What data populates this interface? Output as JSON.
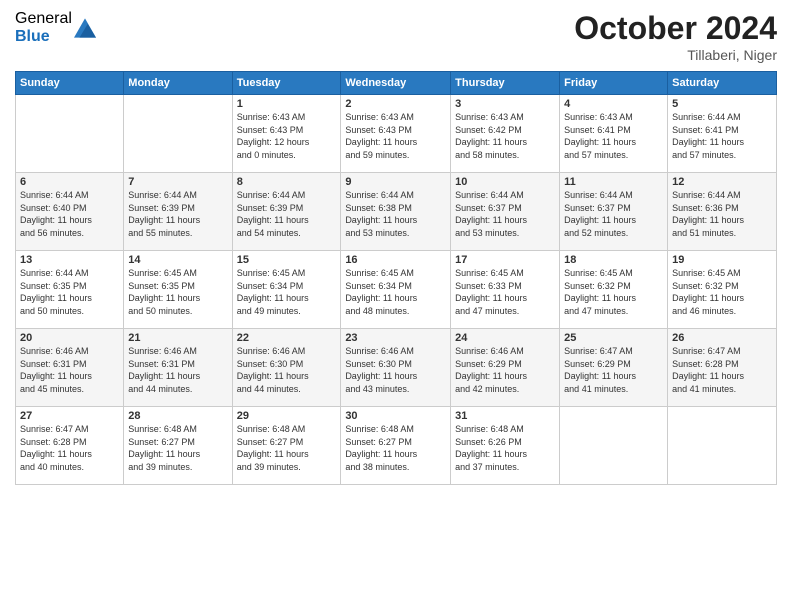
{
  "header": {
    "logo": {
      "general": "General",
      "blue": "Blue"
    },
    "title": "October 2024",
    "location": "Tillaberi, Niger"
  },
  "days_of_week": [
    "Sunday",
    "Monday",
    "Tuesday",
    "Wednesday",
    "Thursday",
    "Friday",
    "Saturday"
  ],
  "weeks": [
    [
      {
        "day": "",
        "info": ""
      },
      {
        "day": "",
        "info": ""
      },
      {
        "day": "1",
        "info": "Sunrise: 6:43 AM\nSunset: 6:43 PM\nDaylight: 12 hours\nand 0 minutes."
      },
      {
        "day": "2",
        "info": "Sunrise: 6:43 AM\nSunset: 6:43 PM\nDaylight: 11 hours\nand 59 minutes."
      },
      {
        "day": "3",
        "info": "Sunrise: 6:43 AM\nSunset: 6:42 PM\nDaylight: 11 hours\nand 58 minutes."
      },
      {
        "day": "4",
        "info": "Sunrise: 6:43 AM\nSunset: 6:41 PM\nDaylight: 11 hours\nand 57 minutes."
      },
      {
        "day": "5",
        "info": "Sunrise: 6:44 AM\nSunset: 6:41 PM\nDaylight: 11 hours\nand 57 minutes."
      }
    ],
    [
      {
        "day": "6",
        "info": "Sunrise: 6:44 AM\nSunset: 6:40 PM\nDaylight: 11 hours\nand 56 minutes."
      },
      {
        "day": "7",
        "info": "Sunrise: 6:44 AM\nSunset: 6:39 PM\nDaylight: 11 hours\nand 55 minutes."
      },
      {
        "day": "8",
        "info": "Sunrise: 6:44 AM\nSunset: 6:39 PM\nDaylight: 11 hours\nand 54 minutes."
      },
      {
        "day": "9",
        "info": "Sunrise: 6:44 AM\nSunset: 6:38 PM\nDaylight: 11 hours\nand 53 minutes."
      },
      {
        "day": "10",
        "info": "Sunrise: 6:44 AM\nSunset: 6:37 PM\nDaylight: 11 hours\nand 53 minutes."
      },
      {
        "day": "11",
        "info": "Sunrise: 6:44 AM\nSunset: 6:37 PM\nDaylight: 11 hours\nand 52 minutes."
      },
      {
        "day": "12",
        "info": "Sunrise: 6:44 AM\nSunset: 6:36 PM\nDaylight: 11 hours\nand 51 minutes."
      }
    ],
    [
      {
        "day": "13",
        "info": "Sunrise: 6:44 AM\nSunset: 6:35 PM\nDaylight: 11 hours\nand 50 minutes."
      },
      {
        "day": "14",
        "info": "Sunrise: 6:45 AM\nSunset: 6:35 PM\nDaylight: 11 hours\nand 50 minutes."
      },
      {
        "day": "15",
        "info": "Sunrise: 6:45 AM\nSunset: 6:34 PM\nDaylight: 11 hours\nand 49 minutes."
      },
      {
        "day": "16",
        "info": "Sunrise: 6:45 AM\nSunset: 6:34 PM\nDaylight: 11 hours\nand 48 minutes."
      },
      {
        "day": "17",
        "info": "Sunrise: 6:45 AM\nSunset: 6:33 PM\nDaylight: 11 hours\nand 47 minutes."
      },
      {
        "day": "18",
        "info": "Sunrise: 6:45 AM\nSunset: 6:32 PM\nDaylight: 11 hours\nand 47 minutes."
      },
      {
        "day": "19",
        "info": "Sunrise: 6:45 AM\nSunset: 6:32 PM\nDaylight: 11 hours\nand 46 minutes."
      }
    ],
    [
      {
        "day": "20",
        "info": "Sunrise: 6:46 AM\nSunset: 6:31 PM\nDaylight: 11 hours\nand 45 minutes."
      },
      {
        "day": "21",
        "info": "Sunrise: 6:46 AM\nSunset: 6:31 PM\nDaylight: 11 hours\nand 44 minutes."
      },
      {
        "day": "22",
        "info": "Sunrise: 6:46 AM\nSunset: 6:30 PM\nDaylight: 11 hours\nand 44 minutes."
      },
      {
        "day": "23",
        "info": "Sunrise: 6:46 AM\nSunset: 6:30 PM\nDaylight: 11 hours\nand 43 minutes."
      },
      {
        "day": "24",
        "info": "Sunrise: 6:46 AM\nSunset: 6:29 PM\nDaylight: 11 hours\nand 42 minutes."
      },
      {
        "day": "25",
        "info": "Sunrise: 6:47 AM\nSunset: 6:29 PM\nDaylight: 11 hours\nand 41 minutes."
      },
      {
        "day": "26",
        "info": "Sunrise: 6:47 AM\nSunset: 6:28 PM\nDaylight: 11 hours\nand 41 minutes."
      }
    ],
    [
      {
        "day": "27",
        "info": "Sunrise: 6:47 AM\nSunset: 6:28 PM\nDaylight: 11 hours\nand 40 minutes."
      },
      {
        "day": "28",
        "info": "Sunrise: 6:48 AM\nSunset: 6:27 PM\nDaylight: 11 hours\nand 39 minutes."
      },
      {
        "day": "29",
        "info": "Sunrise: 6:48 AM\nSunset: 6:27 PM\nDaylight: 11 hours\nand 39 minutes."
      },
      {
        "day": "30",
        "info": "Sunrise: 6:48 AM\nSunset: 6:27 PM\nDaylight: 11 hours\nand 38 minutes."
      },
      {
        "day": "31",
        "info": "Sunrise: 6:48 AM\nSunset: 6:26 PM\nDaylight: 11 hours\nand 37 minutes."
      },
      {
        "day": "",
        "info": ""
      },
      {
        "day": "",
        "info": ""
      }
    ]
  ]
}
